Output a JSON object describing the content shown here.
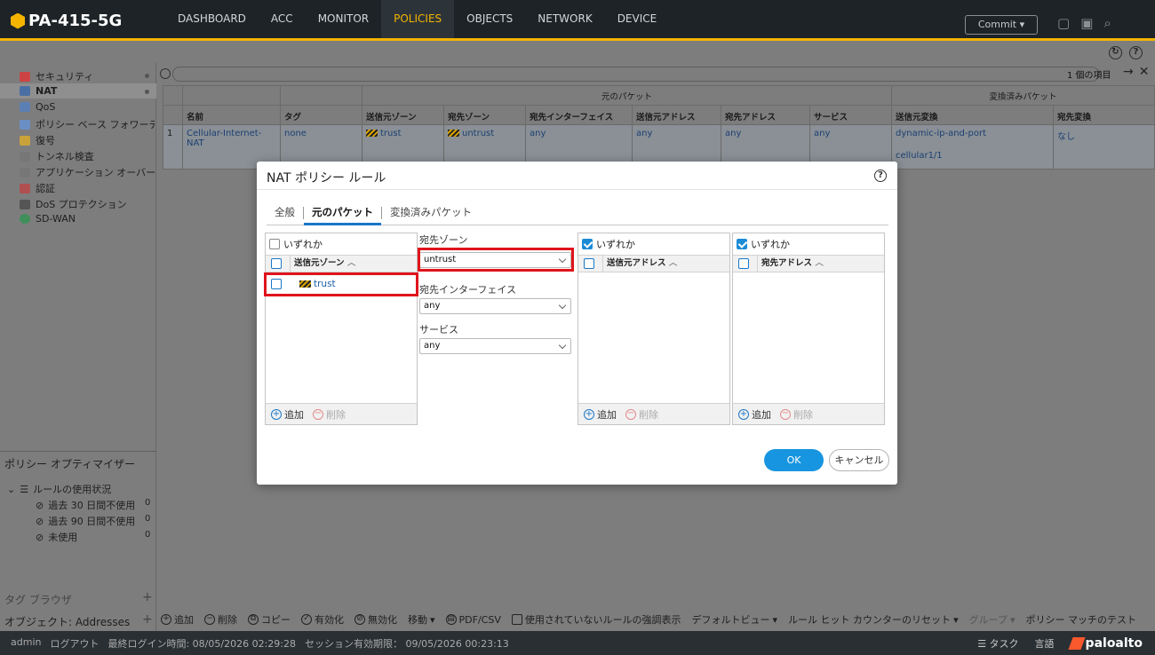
{
  "app": {
    "device_name": "PA-415-5G",
    "commit_label": "Commit"
  },
  "nav": [
    {
      "label": "DASHBOARD"
    },
    {
      "label": "ACC"
    },
    {
      "label": "MONITOR"
    },
    {
      "label": "POLICIES",
      "active": true
    },
    {
      "label": "OBJECTS"
    },
    {
      "label": "NETWORK"
    },
    {
      "label": "DEVICE"
    }
  ],
  "sidebar": {
    "items": [
      {
        "label": "セキュリティ",
        "icon": "security-icon"
      },
      {
        "label": "NAT",
        "icon": "nat-icon",
        "selected": true
      },
      {
        "label": "QoS",
        "icon": "qos-icon"
      },
      {
        "label": "ポリシー ベース フォワーディング",
        "icon": "pbf-icon"
      },
      {
        "label": "復号",
        "icon": "decrypt-icon"
      },
      {
        "label": "トンネル検査",
        "icon": "tunnel-icon"
      },
      {
        "label": "アプリケーション オーバーライド",
        "icon": "app-override-icon"
      },
      {
        "label": "認証",
        "icon": "auth-icon"
      },
      {
        "label": "DoS プロテクション",
        "icon": "dos-icon"
      },
      {
        "label": "SD-WAN",
        "icon": "sdwan-icon"
      }
    ],
    "optimizer_title": "ポリシー オプティマイザー",
    "rule_usage_label": "ルールの使用状況",
    "rule_usage": [
      {
        "label": "過去 30 日間不使用",
        "count": "0"
      },
      {
        "label": "過去 90 日間不使用",
        "count": "0"
      },
      {
        "label": "未使用",
        "count": "0"
      }
    ],
    "tag_browser": "タグ ブラウザ",
    "objects_label": "オブジェクト: Addresses"
  },
  "table": {
    "item_count": "1 個の項目",
    "group_original": "元のパケット",
    "group_translated": "変換済みパケット",
    "headers": [
      "名前",
      "タグ",
      "送信元ゾーン",
      "宛先ゾーン",
      "宛先インターフェイス",
      "送信元アドレス",
      "宛先アドレス",
      "サービス",
      "送信元変換",
      "宛先変換"
    ],
    "row": {
      "index": "1",
      "name": "Cellular-Internet-NAT",
      "tag": "none",
      "src_zone": "trust",
      "dst_zone": "untrust",
      "dst_interface": "any",
      "src_address": "any",
      "dst_address": "any",
      "service": "any",
      "src_translation": "dynamic-ip-and-port",
      "src_translation_iface": "cellular1/1",
      "dst_translation": "なし"
    }
  },
  "bottombar": {
    "add": "追加",
    "delete": "削除",
    "copy": "コピー",
    "enable": "有効化",
    "disable": "無効化",
    "move": "移動",
    "pdf_csv": "PDF/CSV",
    "highlight_unused": "使用されていないルールの強調表示",
    "default_view": "デフォルトビュー",
    "reset_hit": "ルール ヒット カウンターのリセット",
    "group": "グループ",
    "policy_match": "ポリシー マッチのテスト"
  },
  "status": {
    "user": "admin",
    "logout": "ログアウト",
    "last_login": "最終ログイン時間: 08/05/2026 02:29:28",
    "session_expiry": "セッション有効期限： 09/05/2026 00:23:13",
    "tasks": "タスク",
    "language": "言語",
    "brand": "paloalto"
  },
  "dialog": {
    "title": "NAT ポリシー ルール",
    "tabs": [
      {
        "label": "全般"
      },
      {
        "label": "元のパケット",
        "active": true
      },
      {
        "label": "変換済みパケット"
      }
    ],
    "src_zone_panel": {
      "any_label": "いずれか",
      "any_checked": false,
      "header": "送信元ゾーン",
      "items": [
        "trust"
      ]
    },
    "dst_zone_label": "宛先ゾーン",
    "dst_zone_value": "untrust",
    "dst_iface_label": "宛先インターフェイス",
    "dst_iface_value": "any",
    "service_label": "サービス",
    "service_value": "any",
    "src_addr_panel": {
      "any_label": "いずれか",
      "any_checked": true,
      "header": "送信元アドレス"
    },
    "dst_addr_panel": {
      "any_label": "いずれか",
      "any_checked": true,
      "header": "宛先アドレス"
    },
    "add_label": "追加",
    "delete_label": "削除",
    "ok_label": "OK",
    "cancel_label": "キャンセル",
    "highlight_color": "#e0141c"
  }
}
